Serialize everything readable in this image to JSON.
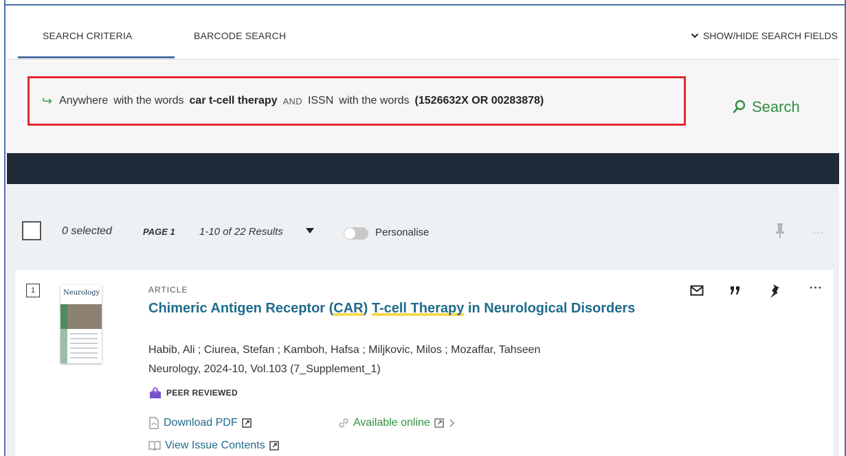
{
  "tabs": {
    "search_criteria": "SEARCH CRITERIA",
    "barcode_search": "BARCODE SEARCH",
    "toggle_fields": "SHOW/HIDE SEARCH FIELDS"
  },
  "query": {
    "field1": "Anywhere",
    "with1": "with the words",
    "term1": "car t-cell therapy",
    "operator": "AND",
    "field2": "ISSN",
    "with2": "with the words",
    "term2": "(1526632X OR 00283878)"
  },
  "search_button": "Search",
  "results_toolbar": {
    "selected": "0 selected",
    "page": "PAGE 1",
    "range": "1-10 of 22 Results",
    "personalise": "Personalise",
    "more": "···"
  },
  "result": {
    "number": "1",
    "thumb_title": "Neurology",
    "type": "ARTICLE",
    "title_parts": {
      "a": "Chimeric Antigen Receptor (",
      "b": "CAR",
      "c": ") ",
      "d": "T-cell Therapy",
      "e": " in Neurological Disorders"
    },
    "authors": "Habib, Ali ; Ciurea, Stefan ; Kamboh, Hafsa ; Miljkovic, Milos ; Mozaffar, Tahseen",
    "source": "Neurology, 2024-10, Vol.103 (7_Supplement_1)",
    "peer_reviewed": "PEER REVIEWED",
    "download_pdf": "Download PDF",
    "available_online": "Available online",
    "view_issue": "View Issue Contents",
    "more": "···"
  },
  "colors": {
    "accent": "#1f6b8c",
    "green": "#2f8f3f",
    "highlight_box": "#e3282f",
    "dark_band": "#1f2a38"
  }
}
